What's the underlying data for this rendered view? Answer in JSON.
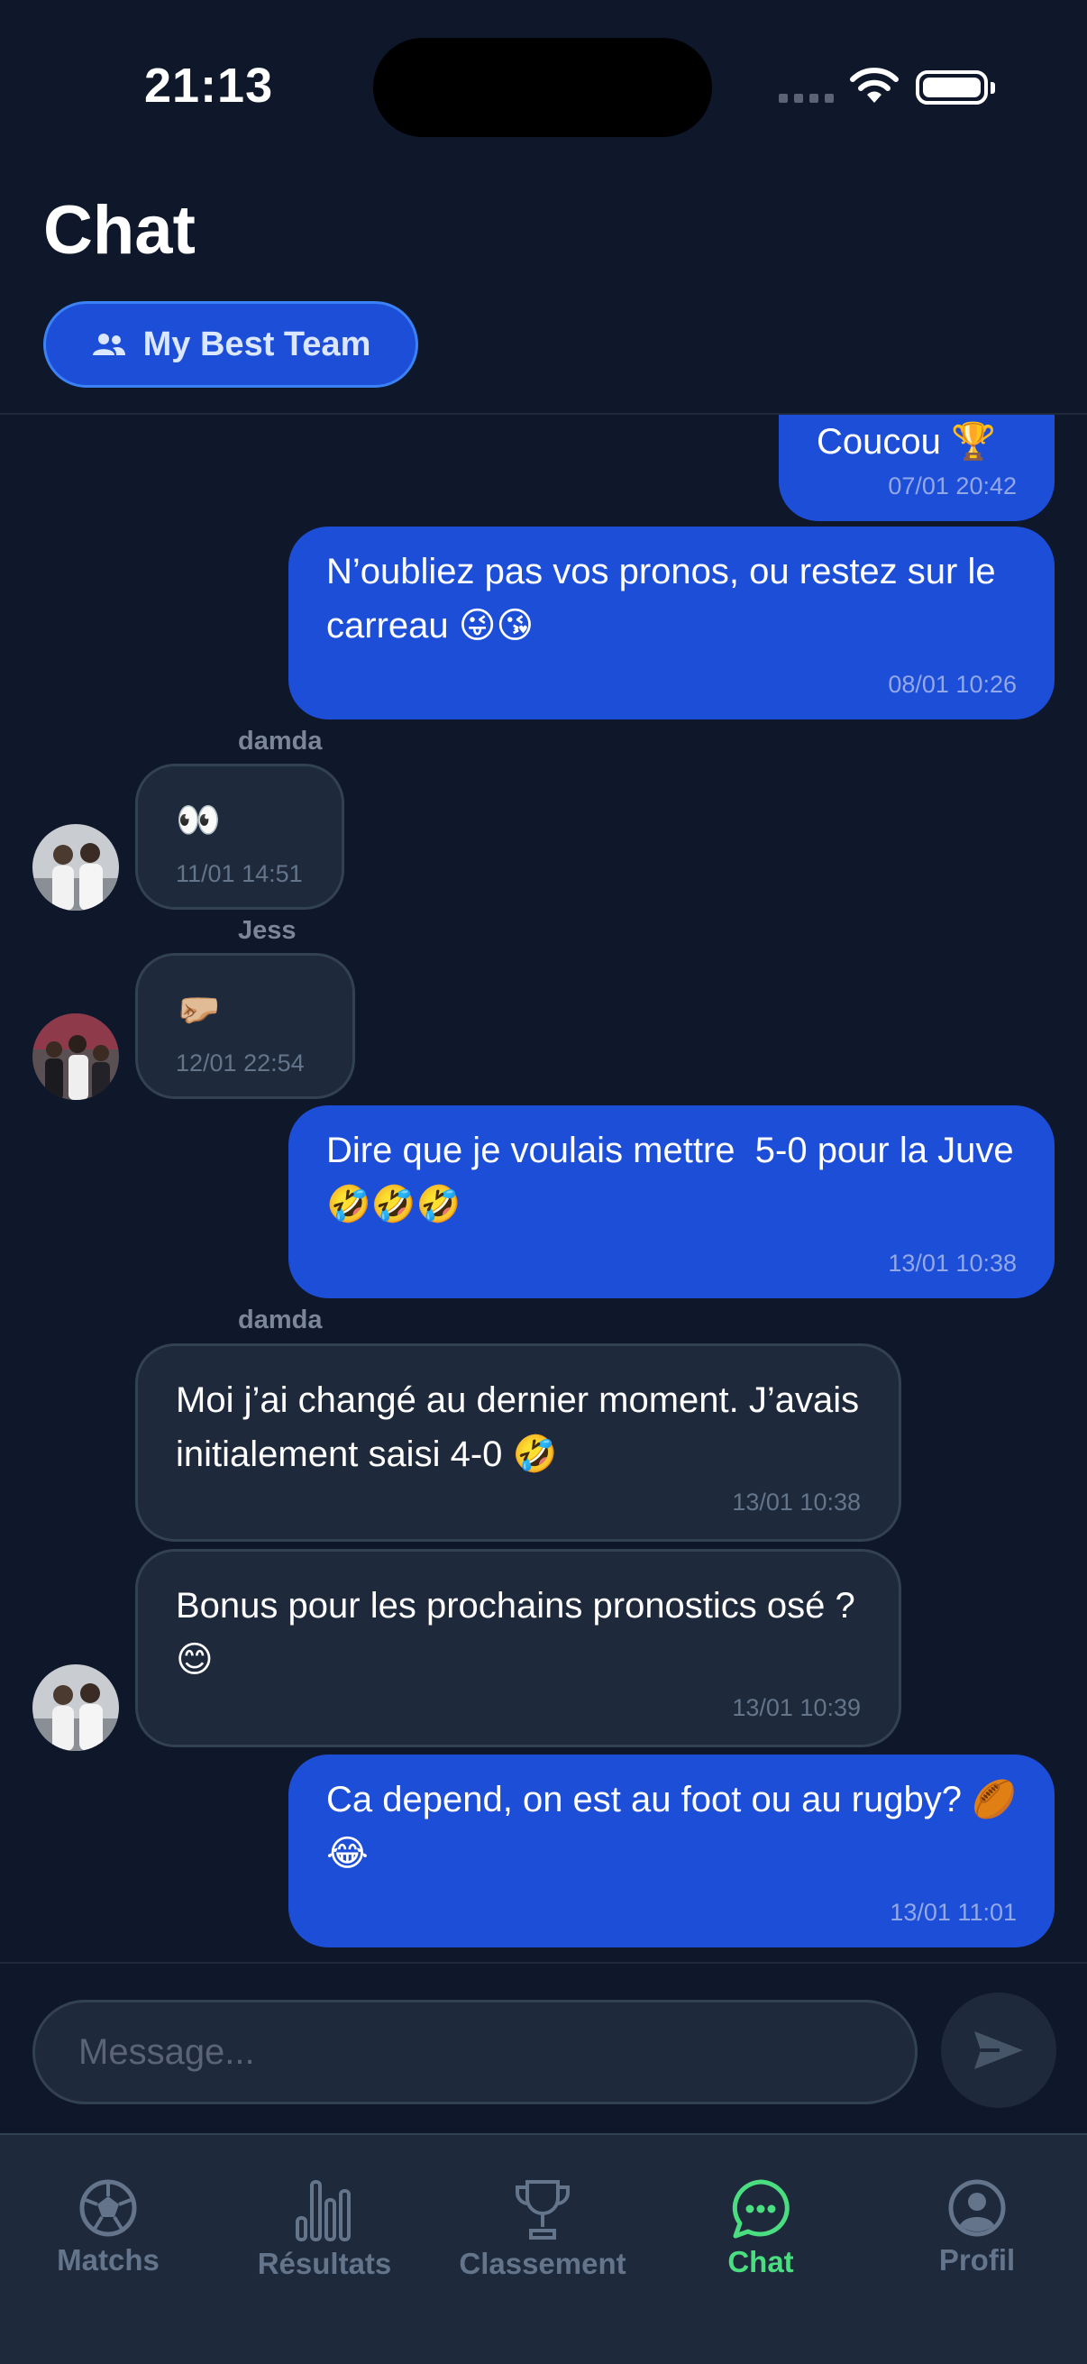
{
  "status_bar": {
    "time": "21:13"
  },
  "header": {
    "title": "Chat",
    "team_button": "My Best Team"
  },
  "messages": [
    {
      "text": "Coucou 🏆",
      "time": "07/01 20:42",
      "mine": true
    },
    {
      "text": "N’oubliez pas vos pronos, ou restez sur le carreau 😜😘",
      "time": "08/01 10:26",
      "mine": true
    },
    {
      "sender": "damda",
      "text": "👀",
      "time": "11/01 14:51",
      "mine": false
    },
    {
      "sender": "Jess",
      "text": "🤛🏼",
      "time": "12/01 22:54",
      "mine": false
    },
    {
      "text": "Dire que je voulais mettre  5-0 pour la Juve 🤣🤣🤣",
      "time": "13/01 10:38",
      "mine": true
    },
    {
      "sender": "damda",
      "text": "Moi j’ai changé au dernier moment. J’avais initialement saisi 4-0 🤣",
      "time": "13/01 10:38",
      "mine": false
    },
    {
      "text": "Bonus pour les prochains pronostics osé ? 😊",
      "time": "13/01 10:39",
      "mine": false
    },
    {
      "text": "Ca depend, on est au foot ou au rugby? 🏉😂",
      "time": "13/01 11:01",
      "mine": true
    }
  ],
  "composer": {
    "placeholder": "Message...",
    "send_icon": "send-icon"
  },
  "tabs": [
    {
      "label": "Matchs",
      "icon": "soccer-ball-icon",
      "active": false
    },
    {
      "label": "Résultats",
      "icon": "bar-chart-icon",
      "active": false
    },
    {
      "label": "Classement",
      "icon": "trophy-icon",
      "active": false
    },
    {
      "label": "Chat",
      "icon": "chat-bubble-icon",
      "active": true
    },
    {
      "label": "Profil",
      "icon": "user-circle-icon",
      "active": false
    }
  ],
  "colors": {
    "background": "#0f172a",
    "my_bubble": "#1d4ed8",
    "other_bubble": "#1e293b",
    "active_tab": "#4ade80"
  }
}
